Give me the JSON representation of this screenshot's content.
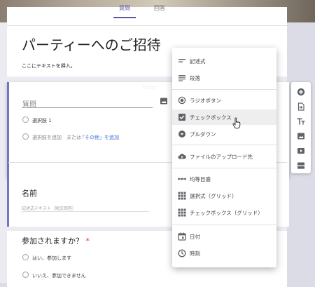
{
  "tabs": [
    {
      "label": "質問"
    },
    {
      "label": "回答"
    }
  ],
  "form": {
    "title": "パーティーへのご招待",
    "description": "ここにテキストを挿入。"
  },
  "question": {
    "placeholder": "質問",
    "option1": "選択肢 1",
    "add_option": "選択肢を追加",
    "or_text": "または",
    "add_other": "「その他」を追加"
  },
  "card2": {
    "title": "名前",
    "placeholder": "記述式テキスト（短文回答）"
  },
  "card3": {
    "title": "参加されますか？",
    "required_mark": "*",
    "options": [
      "はい、参加します",
      "いいえ、参加できません"
    ]
  },
  "menu": {
    "items": [
      {
        "label": "記述式",
        "icon": "short-answer-icon"
      },
      {
        "label": "段落",
        "icon": "paragraph-icon"
      },
      {
        "label": "ラジオボタン",
        "icon": "radio-icon"
      },
      {
        "label": "チェックボックス",
        "icon": "checkbox-icon"
      },
      {
        "label": "プルダウン",
        "icon": "dropdown-icon"
      },
      {
        "label": "ファイルのアップロード先",
        "icon": "cloud-upload-icon"
      },
      {
        "label": "均等目盛",
        "icon": "linear-scale-icon"
      },
      {
        "label": "選択式（グリッド）",
        "icon": "grid-icon"
      },
      {
        "label": "チェックボックス（グリッド）",
        "icon": "checkbox-grid-icon"
      },
      {
        "label": "日付",
        "icon": "calendar-icon"
      },
      {
        "label": "時刻",
        "icon": "clock-icon"
      }
    ],
    "highlighted": "チェックボックス"
  },
  "toolbar": [
    "add-question-icon",
    "import-questions-icon",
    "add-title-icon",
    "add-image-icon",
    "add-video-icon",
    "add-section-icon"
  ],
  "colors": {
    "accent": "#5b55a4",
    "card_border": "#6f74c9",
    "link": "#3b6fcf",
    "required": "#d93025"
  }
}
